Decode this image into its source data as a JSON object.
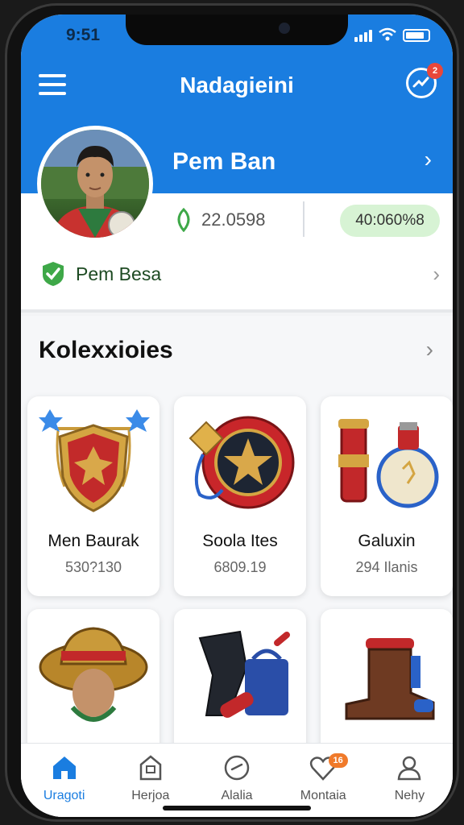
{
  "status_bar": {
    "time": "9:51"
  },
  "header": {
    "title": "Nadagieini",
    "notification_count": "2"
  },
  "profile": {
    "name": "Pem Ban",
    "stat_left": "22.0598",
    "stat_right": "40:060%8",
    "verified_label": "Pem Besa"
  },
  "collections": {
    "title": "Kolexxioies",
    "items": [
      {
        "title": "Men Baurak",
        "subtitle": "530?130",
        "icon": "shield-icon"
      },
      {
        "title": "Soola Ites",
        "subtitle": "6809.19",
        "icon": "emblem-icon"
      },
      {
        "title": "Galuxin",
        "subtitle": "294 Ilanis",
        "icon": "potion-icon"
      },
      {
        "title": "",
        "subtitle": "",
        "icon": "helmet-icon"
      },
      {
        "title": "",
        "subtitle": "",
        "icon": "gear-bag-icon"
      },
      {
        "title": "",
        "subtitle": "",
        "icon": "boot-icon"
      }
    ]
  },
  "bottom_nav": {
    "items": [
      {
        "label": "Uragoti",
        "icon": "home-icon",
        "active": true
      },
      {
        "label": "Herjoa",
        "icon": "building-icon"
      },
      {
        "label": "Alalia",
        "icon": "compass-icon"
      },
      {
        "label": "Montaia",
        "icon": "heart-icon",
        "badge": "16"
      },
      {
        "label": "Nehy",
        "icon": "user-icon"
      }
    ]
  },
  "colors": {
    "primary": "#1a7de0",
    "accent_green": "#d7f3d4",
    "badge_orange": "#f07a2a"
  }
}
